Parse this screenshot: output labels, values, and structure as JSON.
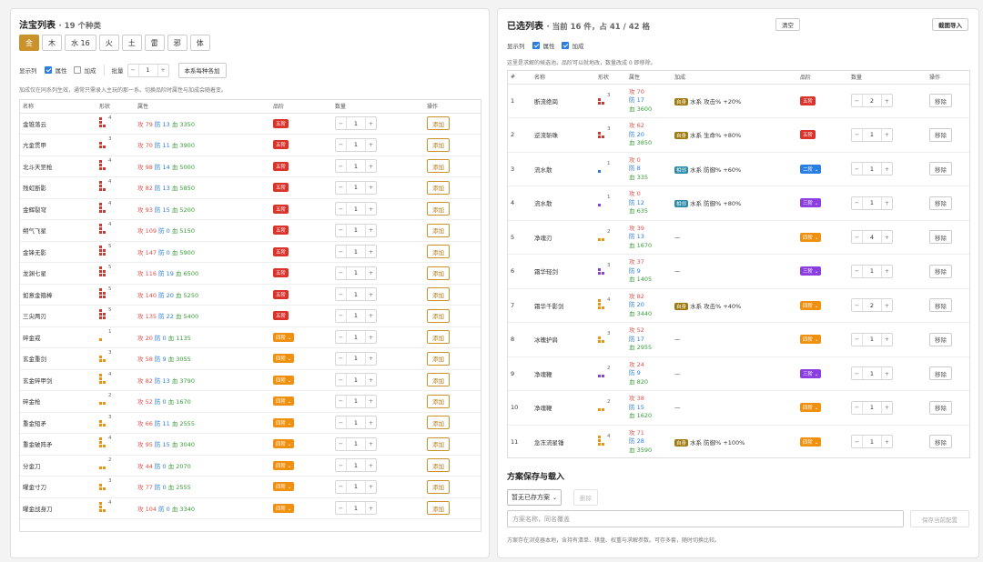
{
  "left": {
    "title": "法宝列表",
    "subtitle": "· 19 个种类",
    "tabs": [
      "金",
      "木",
      "水 16",
      "火",
      "土",
      "雷",
      "邪",
      "体"
    ],
    "active_tab": 0,
    "show_cols_label": "显示列",
    "show_attr_label": "属性",
    "show_bonus_label": "加成",
    "batch_label": "批量",
    "batch_value": "1",
    "add_each_label": "本系每种各加",
    "note": "加成仅在同系列生效，通常只需录入主玩的那一系。切换品阶时属性与加成会随着变。",
    "headers": [
      "名称",
      "形状",
      "属性",
      "品阶",
      "数量",
      "操作"
    ],
    "add_label": "添加",
    "rows": [
      {
        "name": "金锥落云",
        "cells": 4,
        "color": "#d9332b",
        "atk": "攻 79",
        "def": "防 13",
        "hp": "血 3350",
        "grade": "五阶",
        "g": 5,
        "qty": "1"
      },
      {
        "name": "亢金贯甲",
        "cells": 3,
        "color": "#d9332b",
        "atk": "攻 70",
        "def": "防 11",
        "hp": "血 3900",
        "grade": "五阶",
        "g": 5,
        "qty": "1"
      },
      {
        "name": "北斗天罡枪",
        "cells": 4,
        "color": "#d9332b",
        "atk": "攻 98",
        "def": "防 14",
        "hp": "血 5000",
        "grade": "五阶",
        "g": 5,
        "qty": "1"
      },
      {
        "name": "残虹断影",
        "cells": 4,
        "color": "#d9332b",
        "atk": "攻 82",
        "def": "防 13",
        "hp": "血 5850",
        "grade": "五阶",
        "g": 5,
        "qty": "1"
      },
      {
        "name": "金辉裂穹",
        "cells": 4,
        "color": "#d9332b",
        "atk": "攻 93",
        "def": "防 15",
        "hp": "血 5200",
        "grade": "五阶",
        "g": 5,
        "qty": "1"
      },
      {
        "name": "朔气飞星",
        "cells": 4,
        "color": "#d9332b",
        "atk": "攻 109",
        "def": "防 0",
        "hp": "血 5150",
        "grade": "五阶",
        "g": 5,
        "qty": "1"
      },
      {
        "name": "金锋无影",
        "cells": 5,
        "color": "#d9332b",
        "atk": "攻 147",
        "def": "防 0",
        "hp": "血 5900",
        "grade": "五阶",
        "g": 5,
        "qty": "1"
      },
      {
        "name": "龙渊七星",
        "cells": 5,
        "color": "#d9332b",
        "atk": "攻 116",
        "def": "防 19",
        "hp": "血 6500",
        "grade": "五阶",
        "g": 5,
        "qty": "1"
      },
      {
        "name": "如意金箍棒",
        "cells": 5,
        "color": "#d9332b",
        "atk": "攻 140",
        "def": "防 20",
        "hp": "血 5250",
        "grade": "五阶",
        "g": 5,
        "qty": "1"
      },
      {
        "name": "三尖两刃",
        "cells": 5,
        "color": "#d9332b",
        "atk": "攻 135",
        "def": "防 22",
        "hp": "血 5400",
        "grade": "五阶",
        "g": 5,
        "qty": "1"
      },
      {
        "name": "碎金戒",
        "cells": 1,
        "color": "#f0900f",
        "atk": "攻 20",
        "def": "防 0",
        "hp": "血 1135",
        "grade": "四阶",
        "g": 4,
        "qty": "1"
      },
      {
        "name": "玄金重剑",
        "cells": 3,
        "color": "#f0900f",
        "atk": "攻 58",
        "def": "防 9",
        "hp": "血 3055",
        "grade": "四阶",
        "g": 4,
        "qty": "1"
      },
      {
        "name": "玄金碎甲剑",
        "cells": 4,
        "color": "#f0900f",
        "atk": "攻 82",
        "def": "防 13",
        "hp": "血 3790",
        "grade": "四阶",
        "g": 4,
        "qty": "1"
      },
      {
        "name": "碎金枪",
        "cells": 2,
        "color": "#f0900f",
        "atk": "攻 52",
        "def": "防 0",
        "hp": "血 1670",
        "grade": "四阶",
        "g": 4,
        "qty": "1"
      },
      {
        "name": "重金短矛",
        "cells": 3,
        "color": "#f0900f",
        "atk": "攻 66",
        "def": "防 11",
        "hp": "血 2555",
        "grade": "四阶",
        "g": 4,
        "qty": "1"
      },
      {
        "name": "重金破阵矛",
        "cells": 4,
        "color": "#f0900f",
        "atk": "攻 95",
        "def": "防 15",
        "hp": "血 3040",
        "grade": "四阶",
        "g": 4,
        "qty": "1"
      },
      {
        "name": "分金刀",
        "cells": 2,
        "color": "#f0900f",
        "atk": "攻 44",
        "def": "防 0",
        "hp": "血 2070",
        "grade": "四阶",
        "g": 4,
        "qty": "1"
      },
      {
        "name": "曜金寸刀",
        "cells": 3,
        "color": "#f0900f",
        "atk": "攻 77",
        "def": "防 0",
        "hp": "血 2555",
        "grade": "四阶",
        "g": 4,
        "qty": "1"
      },
      {
        "name": "曜金战身刀",
        "cells": 4,
        "color": "#f0900f",
        "atk": "攻 104",
        "def": "防 0",
        "hp": "血 3340",
        "grade": "四阶",
        "g": 4,
        "qty": "1"
      }
    ]
  },
  "right": {
    "title": "已选列表",
    "subtitle": "· 当前 16 件，占 41 / 42 格",
    "clear_label": "清空",
    "screenshot_label": "截图导入",
    "show_cols_label": "显示列",
    "show_attr_label": "属性",
    "show_bonus_label": "加成",
    "note": "这里是求解的候选池。品阶可以就地改，数量改成 0 即移除。",
    "headers": [
      "#",
      "名称",
      "形状",
      "属性",
      "加成",
      "品阶",
      "数量",
      "操作"
    ],
    "remove_label": "移除",
    "rows": [
      {
        "idx": "1",
        "name": "断流绝崗",
        "cells": 3,
        "color": "#d9332b",
        "atk": "攻 70",
        "def": "防 17",
        "hp": "血 3600",
        "tag": "自身",
        "tagtype": "water",
        "bonus": "水系 攻击% +20%",
        "grade": "五阶",
        "g": 5,
        "dd": false,
        "qty": "2"
      },
      {
        "idx": "2",
        "name": "逆流斩珠",
        "cells": 3,
        "color": "#d9332b",
        "atk": "攻 62",
        "def": "防 20",
        "hp": "血 3850",
        "tag": "自身",
        "tagtype": "water",
        "bonus": "水系 生命% +80%",
        "grade": "五阶",
        "g": 5,
        "dd": false,
        "qty": "1"
      },
      {
        "idx": "3",
        "name": "流水散",
        "cells": 1,
        "color": "#2a7de1",
        "atk": "攻 0",
        "def": "防 8",
        "hp": "血 335",
        "tag": "相邻",
        "tagtype": "fortify",
        "bonus": "水系 防御% +60%",
        "grade": "二阶",
        "g": 2,
        "dd": true,
        "qty": "1"
      },
      {
        "idx": "4",
        "name": "流水散",
        "cells": 1,
        "color": "#8b3fe0",
        "atk": "攻 0",
        "def": "防 12",
        "hp": "血 635",
        "tag": "相邻",
        "tagtype": "fortify",
        "bonus": "水系 防御% +80%",
        "grade": "三阶",
        "g": 3,
        "dd": true,
        "qty": "1"
      },
      {
        "idx": "5",
        "name": "净魂刃",
        "cells": 2,
        "color": "#f0900f",
        "atk": "攻 39",
        "def": "防 13",
        "hp": "血 1670",
        "tag": "",
        "tagtype": "",
        "bonus": "—",
        "grade": "四阶",
        "g": 4,
        "dd": true,
        "qty": "4"
      },
      {
        "idx": "6",
        "name": "霜华轻剑",
        "cells": 3,
        "color": "#8b3fe0",
        "atk": "攻 37",
        "def": "防 9",
        "hp": "血 1405",
        "tag": "",
        "tagtype": "",
        "bonus": "—",
        "grade": "三阶",
        "g": 3,
        "dd": true,
        "qty": "1"
      },
      {
        "idx": "7",
        "name": "霜华千影剑",
        "cells": 4,
        "color": "#f0900f",
        "atk": "攻 82",
        "def": "防 20",
        "hp": "血 3440",
        "tag": "自身",
        "tagtype": "water",
        "bonus": "水系 攻击% +40%",
        "grade": "四阶",
        "g": 4,
        "dd": true,
        "qty": "2"
      },
      {
        "idx": "8",
        "name": "冰魄护肩",
        "cells": 3,
        "color": "#f0900f",
        "atk": "攻 52",
        "def": "防 17",
        "hp": "血 2955",
        "tag": "",
        "tagtype": "",
        "bonus": "—",
        "grade": "四阶",
        "g": 4,
        "dd": true,
        "qty": "1"
      },
      {
        "idx": "9",
        "name": "净魂鞭",
        "cells": 2,
        "color": "#8b3fe0",
        "atk": "攻 24",
        "def": "防 9",
        "hp": "血 820",
        "tag": "",
        "tagtype": "",
        "bonus": "—",
        "grade": "三阶",
        "g": 3,
        "dd": true,
        "qty": "1"
      },
      {
        "idx": "10",
        "name": "净魂鞭",
        "cells": 2,
        "color": "#f0900f",
        "atk": "攻 38",
        "def": "防 15",
        "hp": "血 1620",
        "tag": "",
        "tagtype": "",
        "bonus": "—",
        "grade": "四阶",
        "g": 4,
        "dd": true,
        "qty": "1"
      },
      {
        "idx": "11",
        "name": "急冻流星锤",
        "cells": 4,
        "color": "#f0900f",
        "atk": "攻 71",
        "def": "防 28",
        "hp": "血 3590",
        "tag": "自身",
        "tagtype": "water",
        "bonus": "水系 防御% +100%",
        "grade": "四阶",
        "g": 4,
        "dd": true,
        "qty": "1"
      }
    ],
    "save_section": {
      "title": "方案保存与载入",
      "select_value": "暂无已存方案",
      "delete_label": "删除",
      "name_placeholder": "方案名称，同名覆盖",
      "save_label": "保存当前配置",
      "note": "方案存在浏览器本地，含持有清单、棋盘、权重与求解参数。可存多套，随时切换比较。"
    }
  }
}
